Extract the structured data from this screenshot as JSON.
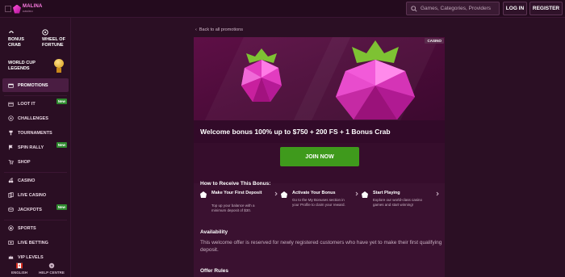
{
  "topbar": {
    "logo_text": "MALINA",
    "logo_sub": "casino",
    "search_placeholder": "Games, Categories, Providers",
    "login_label": "LOG IN",
    "register_label": "REGISTER"
  },
  "sidebar": {
    "featured": [
      {
        "label": "BONUS CRAB",
        "icon": "crab-icon"
      },
      {
        "label": "WHEEL OF FORTUNE",
        "icon": "wheel-icon"
      }
    ],
    "world_cup": "WORLD CUP LEGENDS",
    "items": [
      {
        "label": "PROMOTIONS",
        "icon": "gift-icon",
        "active": true
      },
      {
        "label": "LOOT IT",
        "icon": "chest-icon",
        "badge": "New"
      },
      {
        "label": "CHALLENGES",
        "icon": "target-icon"
      },
      {
        "label": "TOURNAMENTS",
        "icon": "trophy-icon"
      },
      {
        "label": "SPIN RALLY",
        "icon": "flag-icon",
        "badge": "New"
      },
      {
        "label": "SHOP",
        "icon": "cart-icon"
      },
      {
        "label": "CASINO",
        "icon": "cherry-icon"
      },
      {
        "label": "LIVE CASINO",
        "icon": "cards-icon"
      },
      {
        "label": "JACKPOTS",
        "icon": "coins-icon",
        "badge": "New"
      },
      {
        "label": "SPORTS",
        "icon": "ball-icon"
      },
      {
        "label": "LIVE BETTING",
        "icon": "live-icon"
      },
      {
        "label": "VIP LEVELS",
        "icon": "crown-icon"
      }
    ],
    "footer": {
      "language": "ENGLISH",
      "help": "HELP CENTRE"
    }
  },
  "main": {
    "back_link": "Back to all promotions",
    "tag": "CASINO",
    "title": "Welcome bonus 100% up to $750 + 200 FS + 1 Bonus Crab",
    "join_label": "JOIN NOW",
    "how_title": "How to Receive This Bonus:",
    "steps": [
      {
        "title": "Make Your First Deposit",
        "desc": "Top up your balance with a minimum deposit of $30."
      },
      {
        "title": "Activate Your Bonus",
        "desc": "Go to the My Bonuses section in your Profile to claim your reward."
      },
      {
        "title": "Start Playing",
        "desc": "Explore our world-class casino games and start winning!"
      }
    ],
    "availability_title": "Availability",
    "availability_text": "This welcome offer is reserved for newly registered customers who have yet to make their first qualifying deposit.",
    "rules_title": "Offer Rules"
  },
  "colors": {
    "background": "#2b0f24",
    "accent_green": "#3f9a1c",
    "badge_green": "#2f8a2f",
    "brand_pink": "#ff4fd8"
  }
}
